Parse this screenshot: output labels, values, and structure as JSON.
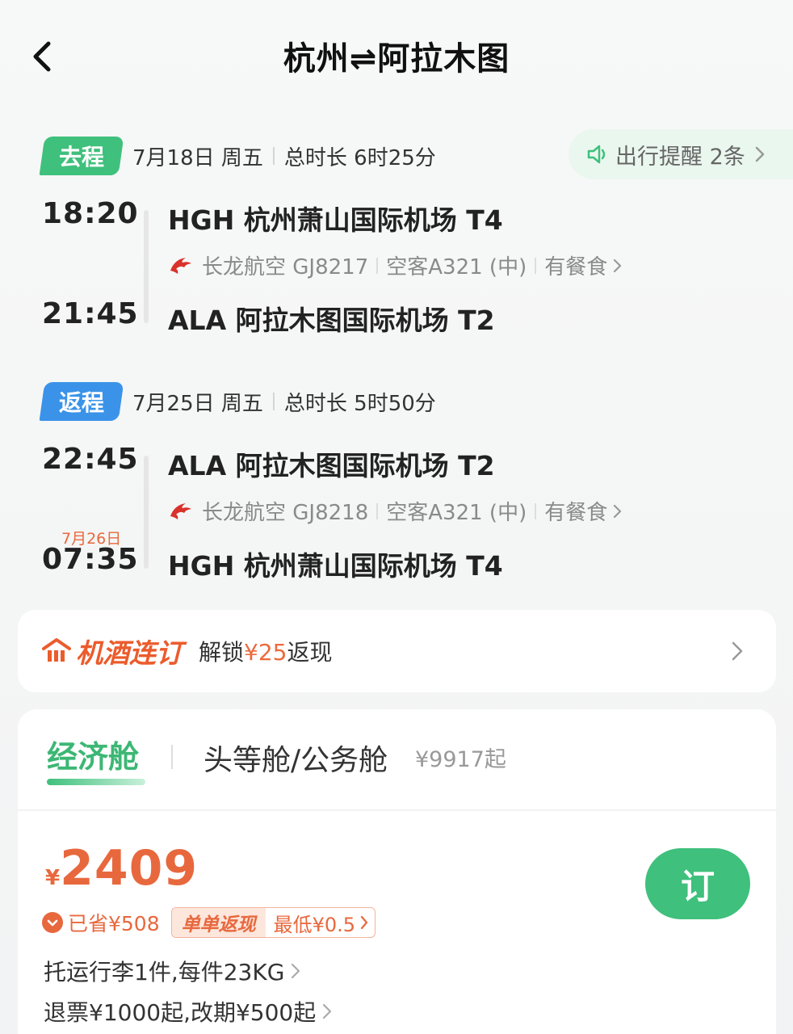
{
  "header": {
    "title": "杭州⇌阿拉木图"
  },
  "reminder": {
    "label": "出行提醒 2条"
  },
  "outbound": {
    "tag": "去程",
    "date": "7月18日 周五",
    "duration": "总时长 6时25分",
    "dep_time": "18:20",
    "dep_airport": "HGH 杭州萧山国际机场 T4",
    "airline": "长龙航空 GJ8217",
    "aircraft": "空客A321 (中)",
    "meal": "有餐食",
    "arr_time": "21:45",
    "arr_airport": "ALA 阿拉木图国际机场 T2"
  },
  "return": {
    "tag": "返程",
    "date": "7月25日 周五",
    "duration": "总时长 5时50分",
    "dep_time": "22:45",
    "dep_airport": "ALA 阿拉木图国际机场 T2",
    "airline": "长龙航空 GJ8218",
    "aircraft": "空客A321 (中)",
    "meal": "有餐食",
    "arr_next_day": "7月26日",
    "arr_time": "07:35",
    "arr_airport": "HGH 杭州萧山国际机场 T4"
  },
  "bundle": {
    "title": "机酒连订",
    "text_prefix": "解锁",
    "amount": "¥25",
    "text_suffix": "返现"
  },
  "cabins": {
    "economy_label": "经济舱",
    "first_label": "头等舱/公务舱",
    "first_price": "¥9917起"
  },
  "fare": {
    "currency": "¥",
    "price": "2409",
    "book_label": "订",
    "saved": "已省¥508",
    "promo_label": "单单返现",
    "promo_value": "最低¥0.5",
    "baggage": "托运行李1件,每件23KG",
    "refund": "退票¥1000起,改期¥500起"
  },
  "colors": {
    "green": "#3fc07c",
    "blue": "#3a93e8",
    "orange": "#e8683e"
  }
}
